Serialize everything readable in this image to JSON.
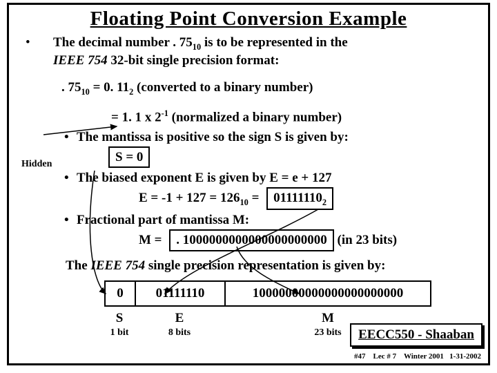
{
  "title": "Floating Point Conversion Example",
  "intro": {
    "pre": "The decimal number  ",
    "num": ". 75",
    "sub": "10",
    "mid": "  is to be represented in the",
    "line2_it": "IEEE 754",
    "line2_rest": "  32-bit single precision format:"
  },
  "conv": {
    "lhs_num": ". 75",
    "lhs_sub": "10",
    "eq": " =  0. 11",
    "bin_sub": "2",
    "note1": "     (converted to a binary number)",
    "line2_eq": "=   1. 1 x 2",
    "line2_sup": "-1",
    "note2": "  (normalized a binary number)"
  },
  "hidden": "Hidden",
  "bullets": {
    "b1": "The mantissa is positive so the sign  S  is given by:",
    "s_eq": "S = 0",
    "b2a": "The biased exponent E is given by   E  =   e  +  127",
    "b2b_pre": "E  =  -1 + 127  =   126",
    "b2b_sub": "10",
    "b2b_eq": "  =   ",
    "b2b_bin": "01111110",
    "b2b_bsub": "2",
    "b3": "Fractional part of mantissa  M:",
    "m_pre": "M  =  ",
    "m_val": ". 1000000000000000000000",
    "m_note": " (in 23 bits)"
  },
  "rep_line_a": "The ",
  "rep_line_it": "IEEE 754",
  "rep_line_b": " single precision representation is given by:",
  "bits": {
    "s": "0",
    "e": "01111110",
    "m": "10000000000000000000000"
  },
  "labels": {
    "s": "S",
    "e": "E",
    "m": "M"
  },
  "sizes": {
    "s": "1 bit",
    "e": "8 bits",
    "m": "23 bits"
  },
  "footer": "EECC550 - Shaaban",
  "meta": {
    "page": "#47",
    "lec": "Lec # 7",
    "term": "Winter 2001",
    "date": "1-31-2002"
  }
}
